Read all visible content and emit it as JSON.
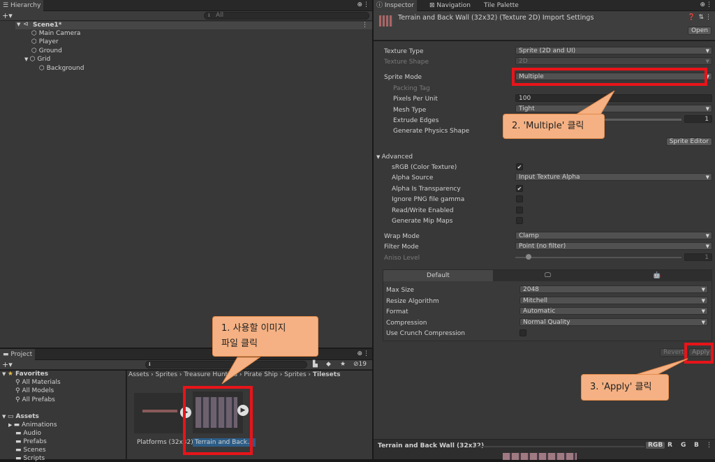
{
  "hierarchy": {
    "tab_label": "Hierarchy",
    "search_placeholder": "All",
    "scene_name": "Scene1*",
    "items": [
      "Main Camera",
      "Player",
      "Ground",
      "Grid"
    ],
    "child_item": "Background"
  },
  "project": {
    "tab_label": "Project",
    "hidden_count": "19",
    "favorites_label": "Favorites",
    "favorites": [
      "All Materials",
      "All Models",
      "All Prefabs"
    ],
    "assets_label": "Assets",
    "folders": [
      "Animations",
      "Audio",
      "Prefabs",
      "Scenes",
      "Scripts"
    ],
    "breadcrumb": [
      "Assets",
      "Sprites",
      "Treasure Hunters",
      "Pirate Ship",
      "Sprites",
      "Tilesets"
    ],
    "files": [
      "Platforms (32x32)",
      "Terrain and Back..."
    ]
  },
  "inspector": {
    "tabs": [
      "Inspector",
      "Navigation",
      "Tile Palette"
    ],
    "title": "Terrain and Back Wall (32x32) (Texture 2D) Import Settings",
    "open_button": "Open",
    "texture_type_label": "Texture Type",
    "texture_type_value": "Sprite (2D and UI)",
    "texture_shape_label": "Texture Shape",
    "texture_shape_value": "2D",
    "sprite_mode_label": "Sprite Mode",
    "sprite_mode_value": "Multiple",
    "packing_tag_label": "Packing Tag",
    "pixels_per_unit_label": "Pixels Per Unit",
    "pixels_per_unit_value": "100",
    "mesh_type_label": "Mesh Type",
    "mesh_type_value": "Tight",
    "extrude_edges_label": "Extrude Edges",
    "extrude_edges_value": "1",
    "extrude_edges_slider": 0.1,
    "physics_shape_label": "Generate Physics Shape",
    "sprite_editor_button": "Sprite Editor",
    "advanced_label": "Advanced",
    "srgb_label": "sRGB (Color Texture)",
    "alpha_source_label": "Alpha Source",
    "alpha_source_value": "Input Texture Alpha",
    "alpha_transparency_label": "Alpha Is Transparency",
    "ignore_png_label": "Ignore PNG file gamma",
    "read_write_label": "Read/Write Enabled",
    "mipmaps_label": "Generate Mip Maps",
    "wrap_mode_label": "Wrap Mode",
    "wrap_mode_value": "Clamp",
    "filter_mode_label": "Filter Mode",
    "filter_mode_value": "Point (no filter)",
    "aniso_label": "Aniso Level",
    "aniso_value": "1",
    "platform_default_tab": "Default",
    "max_size_label": "Max Size",
    "max_size_value": "2048",
    "resize_label": "Resize Algorithm",
    "resize_value": "Mitchell",
    "format_label": "Format",
    "format_value": "Automatic",
    "compression_label": "Compression",
    "compression_value": "Normal Quality",
    "crunch_label": "Use Crunch Compression",
    "revert_button": "Revert",
    "apply_button": "Apply"
  },
  "preview": {
    "title": "Terrain and Back Wall (32x32)",
    "channels": [
      "RGB",
      "R",
      "G",
      "B"
    ]
  },
  "annotations": {
    "step1_line1": "1. 사용할 이미지",
    "step1_line2": "파일 클릭",
    "step2": "2. 'Multiple' 클릭",
    "step3": "3. 'Apply' 클릭"
  },
  "colors": {
    "highlight": "#e8141a",
    "callout": "#f5b183",
    "selection": "#2c5d87"
  }
}
